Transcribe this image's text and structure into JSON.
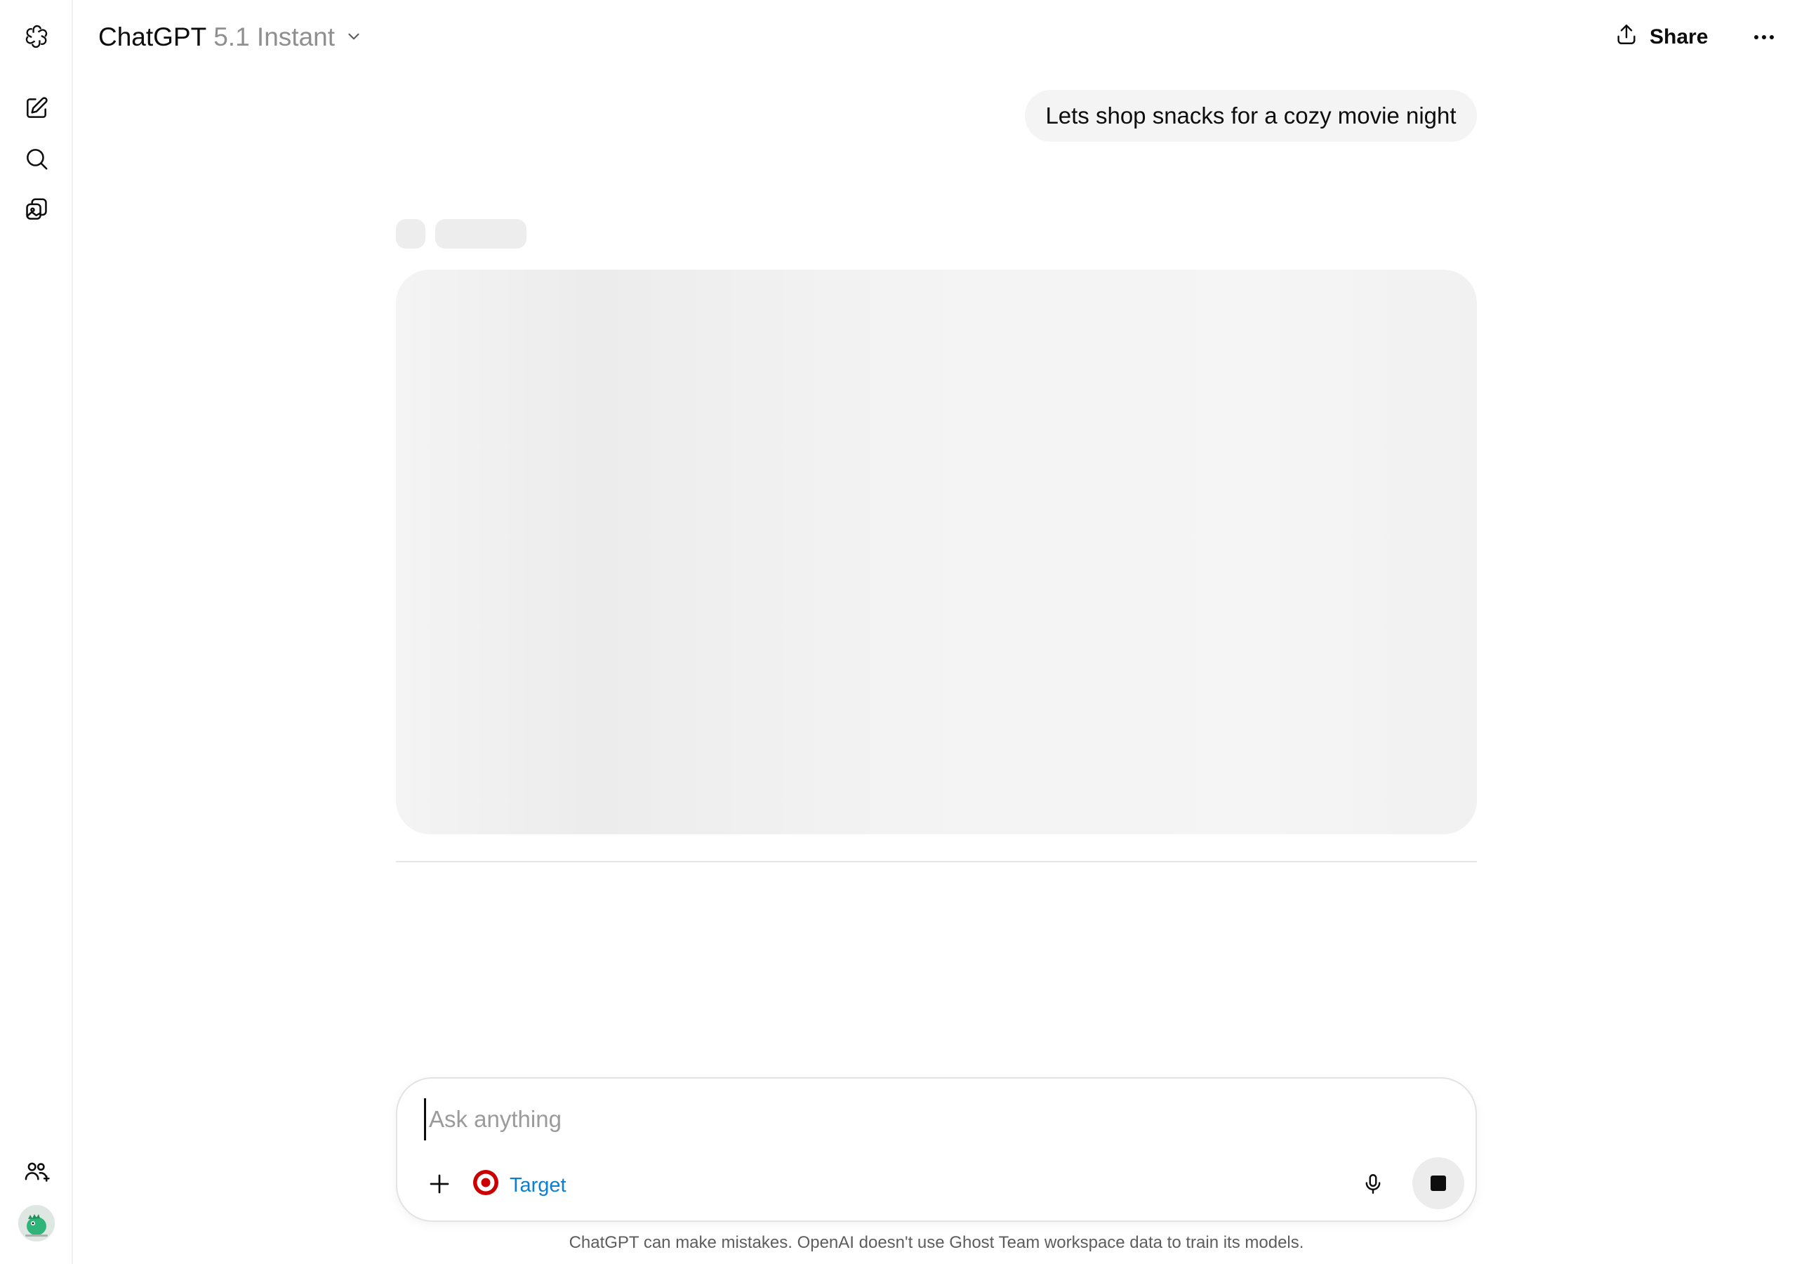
{
  "header": {
    "app_name": "ChatGPT",
    "model_version": "5.1 Instant",
    "share_label": "Share"
  },
  "rail": {
    "items": [
      {
        "icon": "new-chat-icon"
      },
      {
        "icon": "search-icon"
      },
      {
        "icon": "library-icon"
      }
    ],
    "bottom": [
      {
        "icon": "invite-team-icon"
      },
      {
        "icon": "avatar"
      }
    ]
  },
  "conversation": {
    "user_message": "Lets shop snacks for a cozy movie night",
    "assistant_state": "loading"
  },
  "composer": {
    "placeholder": "Ask anything",
    "value": "",
    "app_chip_label": "Target",
    "app_chip_color": "#0b7fd6",
    "target_brand_color": "#cc0000"
  },
  "footer": {
    "disclaimer": "ChatGPT can make mistakes. OpenAI doesn't use Ghost Team workspace data to train its models."
  }
}
